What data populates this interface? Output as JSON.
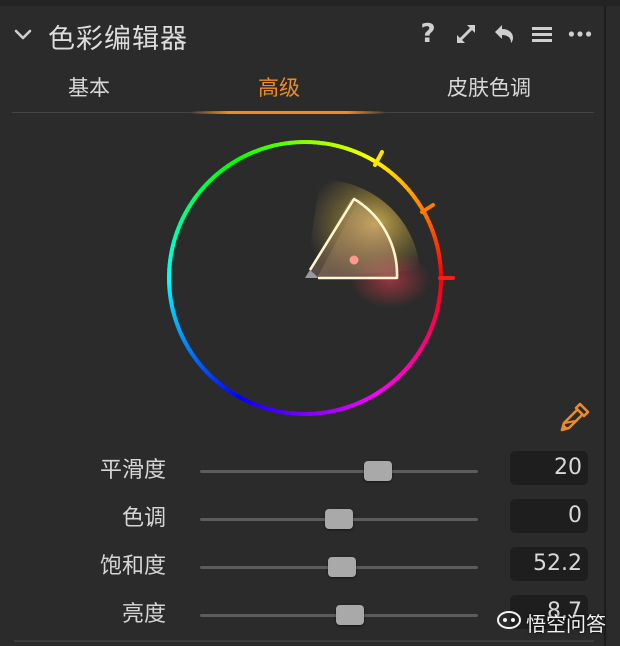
{
  "header": {
    "title": "色彩编辑器",
    "icons": [
      "chevron-down-icon",
      "help-icon",
      "expand-icon",
      "reset-icon",
      "menu-icon",
      "more-icon"
    ],
    "help_glyph": "?"
  },
  "tabs": [
    {
      "label": "基本",
      "active": false
    },
    {
      "label": "高级",
      "active": true
    },
    {
      "label": "皮肤色调",
      "active": false
    }
  ],
  "accent_color": "#f08a24",
  "sliders": [
    {
      "label": "平滑度",
      "value": "20",
      "position": 0.64
    },
    {
      "label": "色调",
      "value": "0",
      "position": 0.5
    },
    {
      "label": "饱和度",
      "value": "52.2",
      "position": 0.51
    },
    {
      "label": "亮度",
      "value": "8.7",
      "position": 0.54
    }
  ],
  "watermark": {
    "text": "悟空问答"
  }
}
